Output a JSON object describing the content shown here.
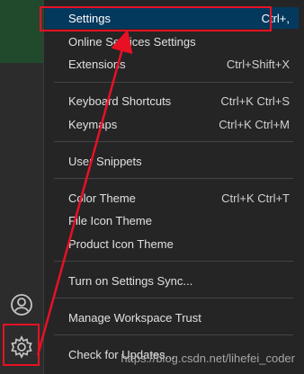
{
  "menu": {
    "items": [
      {
        "label": "Settings",
        "shortcut": "Ctrl+,"
      },
      {
        "label": "Online Services Settings",
        "shortcut": ""
      },
      {
        "label": "Extensions",
        "shortcut": "Ctrl+Shift+X"
      },
      {
        "label": "Keyboard Shortcuts",
        "shortcut": "Ctrl+K Ctrl+S"
      },
      {
        "label": "Keymaps",
        "shortcut": "Ctrl+K Ctrl+M"
      },
      {
        "label": "User Snippets",
        "shortcut": ""
      },
      {
        "label": "Color Theme",
        "shortcut": "Ctrl+K Ctrl+T"
      },
      {
        "label": "File Icon Theme",
        "shortcut": ""
      },
      {
        "label": "Product Icon Theme",
        "shortcut": ""
      },
      {
        "label": "Turn on Settings Sync...",
        "shortcut": ""
      },
      {
        "label": "Manage Workspace Trust",
        "shortcut": ""
      },
      {
        "label": "Check for Updates...",
        "shortcut": ""
      }
    ]
  },
  "activity_bar": {
    "account_icon": "account-icon",
    "manage_icon": "gear-icon"
  },
  "watermark": "https://blog.csdn.net/lihefei_coder",
  "colors": {
    "annotation": "#e81123",
    "active_bg": "#04395e"
  }
}
